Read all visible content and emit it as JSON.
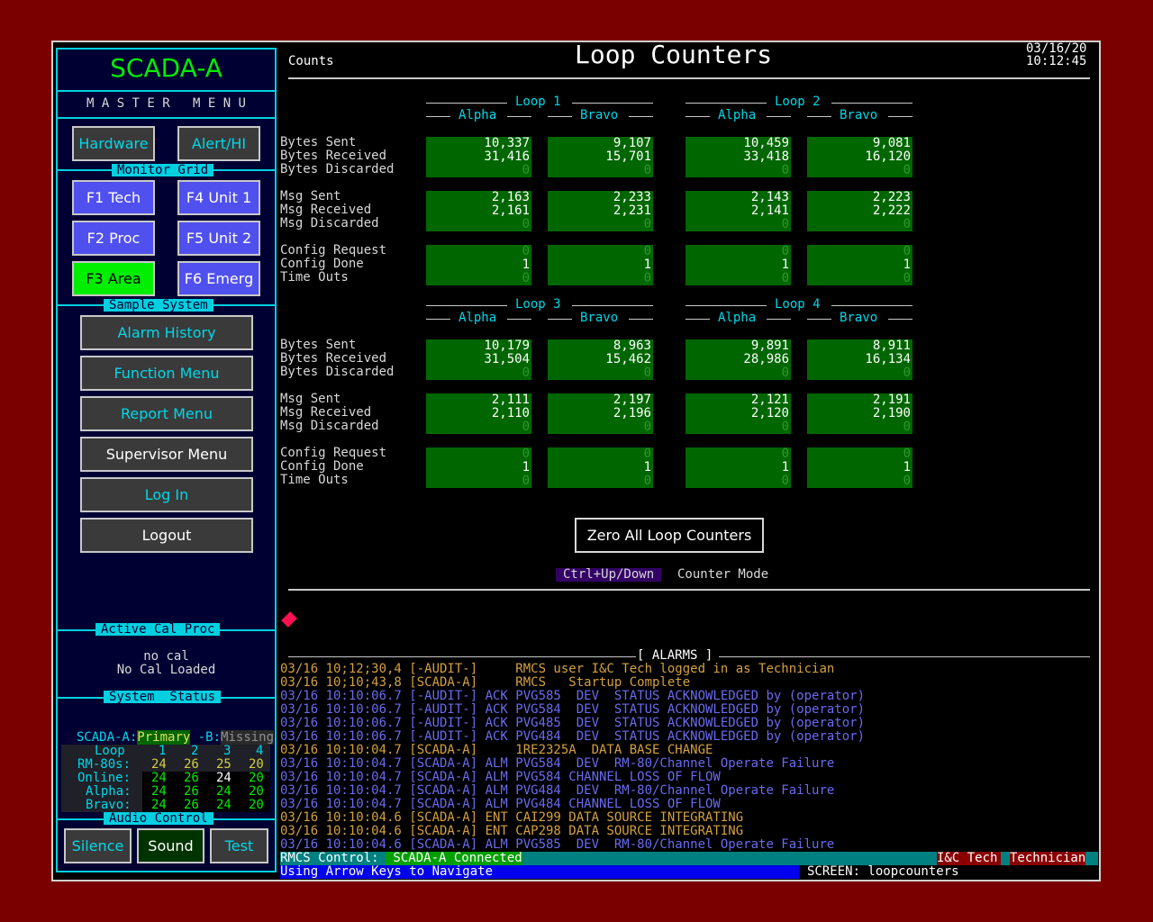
{
  "app": {
    "title": "SCADA-A",
    "master_menu": "M A S T E R   M E N U"
  },
  "header": {
    "mode": "Counts",
    "title": "Loop Counters",
    "date": "03/16/20",
    "time": "10:12:45"
  },
  "buttons": {
    "hardware": "Hardware",
    "alert": "Alert/HI",
    "f1": "F1 Tech",
    "f2": "F2 Proc",
    "f3": "F3 Area",
    "f4": "F4 Unit 1",
    "f5": "F5 Unit 2",
    "f6": "F6 Emerg",
    "alarm_history": "Alarm History",
    "function_menu": "Function Menu",
    "report_menu": "Report Menu",
    "supervisor_menu": "Supervisor Menu",
    "log_in": "Log In",
    "logout": "Logout",
    "silence": "Silence",
    "sound": "Sound",
    "test": "Test",
    "zero": "Zero All Loop Counters"
  },
  "sections": {
    "monitor_grid": "Monitor Grid",
    "sample_system": "Sample System",
    "active_cal": "Active Cal Proc",
    "system_status": "System  Status",
    "audio_control": "Audio Control"
  },
  "cal": {
    "line1": "no cal",
    "line2": "No Cal Loaded"
  },
  "status": {
    "prefix": "SCADA-A:",
    "primary": "Primary",
    "b_label": " -B:",
    "missing": "Missing"
  },
  "grid": {
    "header_label": "Loop",
    "cols": [
      "1",
      "2",
      "3",
      "4"
    ],
    "rows": [
      {
        "label": "RM-80s:",
        "values": [
          "24",
          "26",
          "25",
          "20"
        ]
      },
      {
        "label": "Online:",
        "values": [
          "24",
          "26",
          "24",
          "20"
        ]
      },
      {
        "label": "Alpha:",
        "values": [
          "24",
          "26",
          "24",
          "20"
        ]
      },
      {
        "label": "Bravo:",
        "values": [
          "24",
          "26",
          "24",
          "20"
        ]
      }
    ]
  },
  "row_labels": [
    "Bytes Sent",
    "Bytes Received",
    "Bytes Discarded",
    "Msg Sent",
    "Msg Received",
    "Msg Discarded",
    "Config Request",
    "Config Done",
    "Time Outs"
  ],
  "loops": [
    {
      "name": "Loop 1",
      "alpha": "Alpha",
      "bravo": "Bravo",
      "a": [
        [
          "10,337",
          "31,416",
          "0"
        ],
        [
          "2,163",
          "2,161",
          "0"
        ],
        [
          "0",
          "1",
          "0"
        ]
      ],
      "b": [
        [
          "9,107",
          "15,701",
          "0"
        ],
        [
          "2,233",
          "2,231",
          "0"
        ],
        [
          "0",
          "1",
          "0"
        ]
      ]
    },
    {
      "name": "Loop 2",
      "alpha": "Alpha",
      "bravo": "Bravo",
      "a": [
        [
          "10,459",
          "33,418",
          "0"
        ],
        [
          "2,143",
          "2,141",
          "0"
        ],
        [
          "0",
          "1",
          "0"
        ]
      ],
      "b": [
        [
          "9,081",
          "16,120",
          "0"
        ],
        [
          "2,223",
          "2,222",
          "0"
        ],
        [
          "0",
          "1",
          "0"
        ]
      ]
    },
    {
      "name": "Loop 3",
      "alpha": "Alpha",
      "bravo": "Bravo",
      "a": [
        [
          "10,179",
          "31,504",
          "0"
        ],
        [
          "2,111",
          "2,110",
          "0"
        ],
        [
          "0",
          "1",
          "0"
        ]
      ],
      "b": [
        [
          "8,963",
          "15,462",
          "0"
        ],
        [
          "2,197",
          "2,196",
          "0"
        ],
        [
          "0",
          "1",
          "0"
        ]
      ]
    },
    {
      "name": "Loop 4",
      "alpha": "Alpha",
      "bravo": "Bravo",
      "a": [
        [
          "9,891",
          "28,986",
          "0"
        ],
        [
          "2,121",
          "2,120",
          "0"
        ],
        [
          "0",
          "1",
          "0"
        ]
      ],
      "b": [
        [
          "8,911",
          "16,134",
          "0"
        ],
        [
          "2,191",
          "2,190",
          "0"
        ],
        [
          "0",
          "1",
          "0"
        ]
      ]
    }
  ],
  "hint": {
    "key": "Ctrl+Up/Down",
    "text": "Counter Mode"
  },
  "alarms_title": "[ ALARMS ]",
  "alarms": [
    {
      "text": "03/16 10;12;30,4 [-AUDIT-]     RMCS user I&C Tech logged in as Technician",
      "color": "#d4a040"
    },
    {
      "text": "03/16 10;10;43,8 [SCADA-A]     RMCS   Startup Complete",
      "color": "#d4a040"
    },
    {
      "text": "03/16 10:10:06.7 [-AUDIT-] ACK PVG585  DEV  STATUS ACKNOWLEDGED by (operator)",
      "color": "#6a6af0"
    },
    {
      "text": "03/16 10:10:06.7 [-AUDIT-] ACK PVG584  DEV  STATUS ACKNOWLEDGED by (operator)",
      "color": "#6a6af0"
    },
    {
      "text": "03/16 10:10:06.7 [-AUDIT-] ACK PVG485  DEV  STATUS ACKNOWLEDGED by (operator)",
      "color": "#6a6af0"
    },
    {
      "text": "03/16 10:10:06.7 [-AUDIT-] ACK PVG484  DEV  STATUS ACKNOWLEDGED by (operator)",
      "color": "#6a6af0"
    },
    {
      "text": "03/16 10:10:04.7 [SCADA-A]     1RE2325A  DATA BASE CHANGE",
      "color": "#d4a040"
    },
    {
      "text": "03/16 10:10:04.7 [SCADA-A] ALM PVG584  DEV  RM-80/Channel Operate Failure",
      "color": "#6a6af0"
    },
    {
      "text": "03/16 10:10:04.7 [SCADA-A] ALM PVG584 CHANNEL LOSS OF FLOW",
      "color": "#6a6af0"
    },
    {
      "text": "03/16 10:10:04.7 [SCADA-A] ALM PVG484  DEV  RM-80/Channel Operate Failure",
      "color": "#6a6af0"
    },
    {
      "text": "03/16 10:10:04.7 [SCADA-A] ALM PVG484 CHANNEL LOSS OF FLOW",
      "color": "#6a6af0"
    },
    {
      "text": "03/16 10:10:04.6 [SCADA-A] ENT CAI299 DATA SOURCE INTEGRATING",
      "color": "#d4a040"
    },
    {
      "text": "03/16 10:10:04.6 [SCADA-A] ENT CAP298 DATA SOURCE INTEGRATING",
      "color": "#d4a040"
    },
    {
      "text": "03/16 10:10:04.6 [SCADA-A] ALM PVG585  DEV  RM-80/Channel Operate Failure",
      "color": "#6a6af0"
    }
  ],
  "statusbar": {
    "control": "RMCS Control:",
    "connected": " SCADA-A Connected",
    "user": "I&C Tech",
    "role": "Technician",
    "nav": "Using Arrow Keys to Navigate",
    "screen": "SCREEN: loopcounters"
  },
  "colors": {
    "cyan": "#00d8e8",
    "cell_green": "#006600",
    "bg_red": "#7a0000"
  }
}
